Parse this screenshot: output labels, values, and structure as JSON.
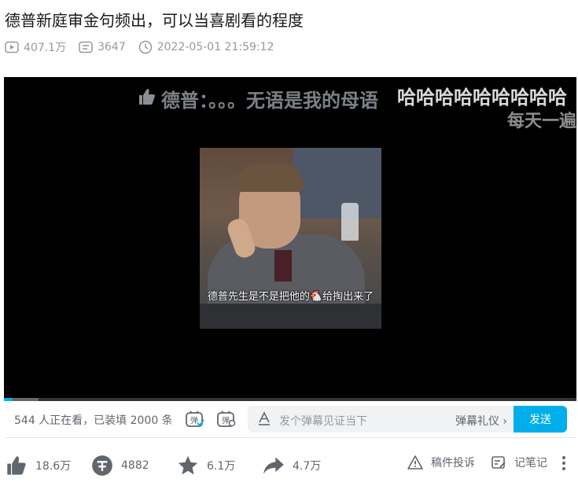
{
  "video": {
    "title": "德普新庭审金句频出，可以当喜剧看的程度",
    "views": "407.1万",
    "danmaku_count": "3647",
    "publish_time": "2022-05-01 21:59:12",
    "caption": "德普先生是不是把他的🐔给掏出来了",
    "progress_pct": 1.5,
    "buffered_pct": 6
  },
  "danmaku": {
    "line1": "德普：。。。无语是我的母语",
    "line2": "哈哈哈哈哈哈哈哈哈",
    "line3": "每天一遍"
  },
  "send_bar": {
    "viewers": "544 人正在看，已装填 2000 条弹幕",
    "placeholder": "发个弹幕见证当下",
    "etiquette": "弹幕礼仪 ›",
    "send_label": "发送"
  },
  "toolbar": {
    "like": "18.6万",
    "coin": "4882",
    "favorite": "6.1万",
    "share": "4.7万",
    "report": "稿件投诉",
    "notes": "记笔记"
  },
  "colors": {
    "accent": "#00aeec",
    "text_secondary": "#9499a0",
    "icon": "#61666d"
  }
}
